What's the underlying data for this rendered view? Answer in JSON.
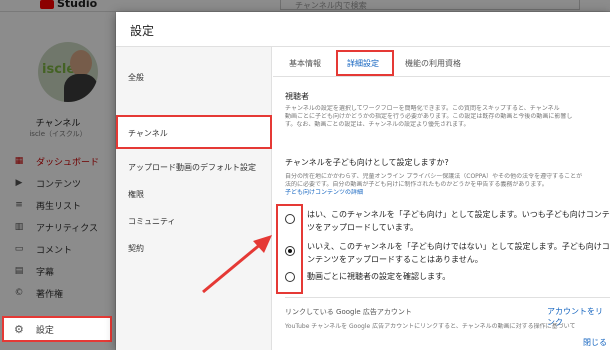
{
  "studio": {
    "logo_text": "Studio",
    "search_placeholder": "チャンネル内で検索",
    "avatar_brand": "iscle",
    "channel_name": "チャンネル",
    "channel_handle": "iscle（イスクル）",
    "nav": [
      {
        "label": "ダッシュボード",
        "icon": "dashboard-icon"
      },
      {
        "label": "コンテンツ",
        "icon": "content-icon"
      },
      {
        "label": "再生リスト",
        "icon": "playlist-icon"
      },
      {
        "label": "アナリティクス",
        "icon": "analytics-icon"
      },
      {
        "label": "コメント",
        "icon": "comment-icon"
      },
      {
        "label": "字幕",
        "icon": "subtitles-icon"
      },
      {
        "label": "著作権",
        "icon": "copyright-icon"
      }
    ],
    "settings_label": "設定"
  },
  "dialog": {
    "title": "設定",
    "left_items": [
      "全般",
      "チャンネル",
      "アップロード動画のデフォルト設定",
      "権限",
      "コミュニティ",
      "契約"
    ],
    "tabs": [
      "基本情報",
      "詳細設定",
      "機能の利用資格"
    ],
    "audience": {
      "title": "視聴者",
      "desc1": "チャンネルの設定を選択してワークフローを簡略化できます。この質問をスキップすると、チャンネル",
      "desc2": "動画ごとに子ども向けかどうかの指定を行う必要があります。この設定は既存の動画と今後の動画に影響し",
      "desc3": "す。なお、動画ごとの設定は、チャンネルの設定より優先されます。",
      "question": "チャンネルを子ども向けとして設定しますか?",
      "legal1": "自分の所在地にかかわらず、児童オンライン プライバシー保護法（COPPA）やその他の法令を遵守することが",
      "legal2": "法的に必要です。自分の動画が子ども向けに制作されたものかどうかを申告する義務があります。",
      "legal_link": "子ども向けコンテンツの詳細",
      "options": [
        {
          "line1": "はい、このチャンネルを「子ども向け」として設定します。いつも子ども向けコンテン",
          "line2": "ツをアップロードしています。",
          "checked": false
        },
        {
          "line1": "いいえ、このチャンネルを「子ども向けではない」として設定します。子ども向けコ",
          "line2": "ンテンツをアップロードすることはありません。",
          "checked": true
        },
        {
          "line1": "動画ごとに視聴者の設定を確認します。",
          "line2": "",
          "checked": false
        }
      ]
    },
    "ads_label": "リンクしている Google 広告アカウント",
    "ads_link": "アカウントをリンク",
    "ads_desc": "YouTube チャンネルを Google 広告アカウントにリンクすると、チャンネルの動画に対する操作に基づいて",
    "close_label": "閉じる"
  },
  "colors": {
    "accent_red": "#e53935",
    "link_blue": "#1565c0",
    "brand_red": "#ff0000"
  }
}
